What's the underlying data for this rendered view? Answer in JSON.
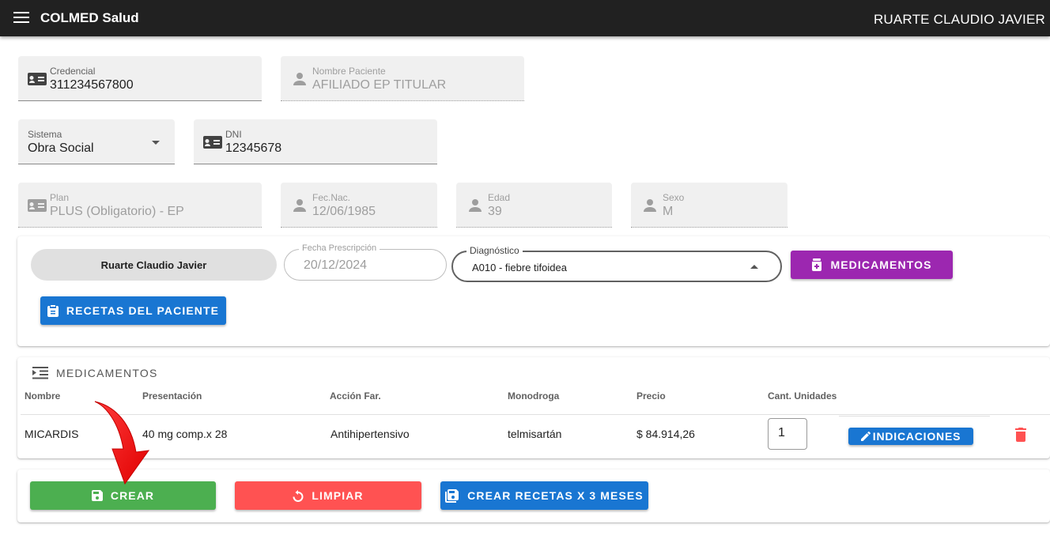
{
  "appbar": {
    "title": "COLMED Salud",
    "user": "RUARTE CLAUDIO JAVIER"
  },
  "patient": {
    "credencial": {
      "label": "Credencial",
      "value": "311234567800"
    },
    "nombre": {
      "label": "Nombre Paciente",
      "value": "AFILIADO EP TITULAR"
    },
    "sistema": {
      "label": "Sistema",
      "value": "Obra Social"
    },
    "dni": {
      "label": "DNI",
      "value": "12345678"
    },
    "plan": {
      "label": "Plan",
      "value": "PLUS (Obligatorio) - EP"
    },
    "fecnac": {
      "label": "Fec.Nac.",
      "value": "12/06/1985"
    },
    "edad": {
      "label": "Edad",
      "value": "39"
    },
    "sexo": {
      "label": "Sexo",
      "value": "M"
    }
  },
  "prescription": {
    "doctor": "Ruarte Claudio Javier",
    "fecha": {
      "label": "Fecha Prescripción",
      "value": "20/12/2024"
    },
    "diagnostico": {
      "label": "Diagnóstico",
      "value": "A010 - fiebre tifoidea"
    },
    "medicamentos_button": "MEDICAMENTOS",
    "recetas_button": "RECETAS DEL PACIENTE"
  },
  "medicamentos": {
    "title": "MEDICAMENTOS",
    "headers": [
      "Nombre",
      "Presentación",
      "Acción Far.",
      "Monodroga",
      "Precio",
      "Cant. Unidades"
    ],
    "rows": [
      {
        "nombre": "MICARDIS",
        "presentacion": "40 mg comp.x 28",
        "accion": "Antihipertensivo",
        "monodroga": "telmisartán",
        "precio": "$ 84.914,26",
        "cantidad": "1",
        "indicaciones_label": "INDICACIONES"
      }
    ]
  },
  "actions": {
    "crear": "CREAR",
    "limpiar": "LIMPIAR",
    "crear_3_meses": "CREAR RECETAS X 3 MESES"
  },
  "colors": {
    "appbar": "#212121",
    "purple": "#9c27b0",
    "blue": "#1976d2",
    "green": "#4caf50",
    "red": "#ff5252",
    "arrow": "#ff1a1a"
  },
  "icons": [
    "menu-icon",
    "badge-icon",
    "person-icon",
    "arrow-drop-down-icon",
    "arrow-drop-up-icon",
    "medication-icon",
    "clipboard-icon",
    "list-indent-icon",
    "pencil-icon",
    "delete-icon",
    "save-icon",
    "restart-icon",
    "save-multiple-icon",
    "annotation-arrow"
  ]
}
